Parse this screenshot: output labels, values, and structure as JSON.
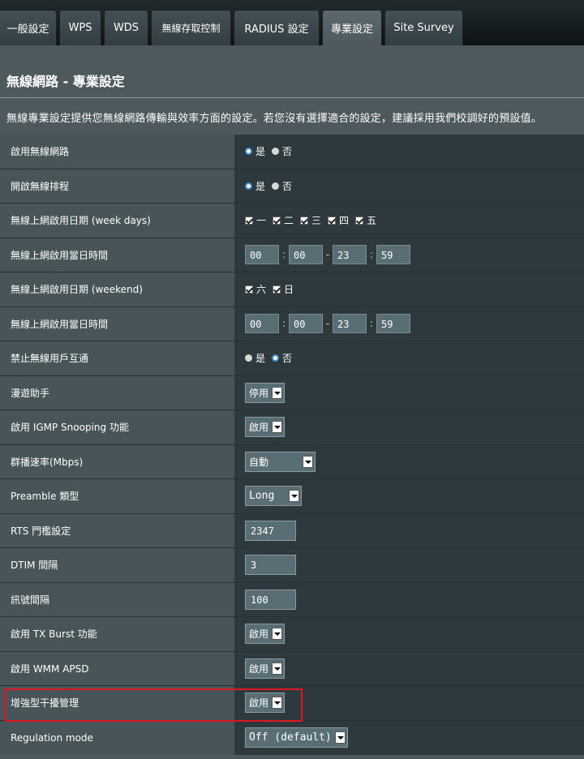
{
  "tabs": [
    {
      "label": "一般設定",
      "active": false
    },
    {
      "label": "WPS",
      "active": false
    },
    {
      "label": "WDS",
      "active": false
    },
    {
      "label": "無線存取控制",
      "active": false
    },
    {
      "label": "RADIUS 設定",
      "active": false
    },
    {
      "label": "專業設定",
      "active": true
    },
    {
      "label": "Site Survey",
      "active": false
    }
  ],
  "page": {
    "title": "無線網路 - 專業設定",
    "description": "無線專業設定提供您無線網路傳輸與效率方面的設定。若您沒有選擇適合的設定，建議採用我們校調好的預設值。"
  },
  "colors": {
    "background": "#4d595d",
    "label_cell": "#475559",
    "value_cell": "#2e393d",
    "highlight": "#e0161e"
  },
  "settings": {
    "enable_wireless": {
      "label": "啟用無線網路",
      "yes": "是",
      "no": "否",
      "selected": "是"
    },
    "enable_schedule": {
      "label": "開啟無線排程",
      "yes": "是",
      "no": "否",
      "selected": "是"
    },
    "weekday_dates": {
      "label": "無線上網啟用日期 (week days)",
      "days": [
        "一",
        "二",
        "三",
        "四",
        "五"
      ]
    },
    "weekday_time": {
      "label": "無線上網啟用當日時間",
      "start_h": "00",
      "start_m": "00",
      "end_h": "23",
      "end_m": "59",
      "colon": ":",
      "dash": "-"
    },
    "weekend_dates": {
      "label": "無線上網啟用日期 (weekend)",
      "days": [
        "六",
        "日"
      ]
    },
    "weekend_time": {
      "label": "無線上網啟用當日時間",
      "start_h": "00",
      "start_m": "00",
      "end_h": "23",
      "end_m": "59",
      "colon": ":",
      "dash": "-"
    },
    "ap_isolation": {
      "label": "禁止無線用戶互通",
      "yes": "是",
      "no": "否",
      "selected": "否"
    },
    "roaming_assistant": {
      "label": "漫遊助手",
      "value": "停用"
    },
    "igmp_snooping": {
      "label": "啟用 IGMP Snooping 功能",
      "value": "啟用"
    },
    "multicast_rate": {
      "label": "群播速率(Mbps)",
      "value": "自動"
    },
    "preamble": {
      "label": "Preamble 類型",
      "value": "Long"
    },
    "rts": {
      "label": "RTS 門檻設定",
      "value": "2347"
    },
    "dtim": {
      "label": "DTIM 間隔",
      "value": "3"
    },
    "beacon": {
      "label": "訊號間隔",
      "value": "100"
    },
    "tx_burst": {
      "label": "啟用 TX Burst 功能",
      "value": "啟用"
    },
    "wmm_apsd": {
      "label": "啟用 WMM APSD",
      "value": "啟用"
    },
    "interference_mgmt": {
      "label": "增強型干擾管理",
      "value": "啟用"
    },
    "regulation_mode": {
      "label": "Regulation mode",
      "value": "Off (default)"
    }
  }
}
